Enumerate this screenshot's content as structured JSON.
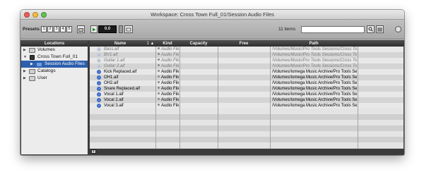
{
  "window": {
    "title": "Workspace: Cross Town Full_01/Session Audio Files"
  },
  "toolbar": {
    "presets_label": "Presets:",
    "presets": [
      "1",
      "2",
      "3",
      "4",
      "5"
    ],
    "zoom_value": "0.0",
    "item_count": "11 items",
    "search_placeholder": ""
  },
  "locations": {
    "header": "Locations",
    "items": [
      {
        "label": "Volumes",
        "icon": "folder-icon",
        "expanded": false
      },
      {
        "label": "Cross Town Full_01",
        "icon": "session-icon",
        "expanded": true
      },
      {
        "label": "Session Audio Files",
        "icon": "blue-folder-icon",
        "expanded": false,
        "selected": true
      },
      {
        "label": "Catalogs",
        "icon": "folder-icon",
        "expanded": false
      },
      {
        "label": "User",
        "icon": "folder-icon",
        "expanded": false
      }
    ]
  },
  "files": {
    "columns": {
      "name": "Name",
      "sort_indicator": "1 ▲",
      "kind": "Kind",
      "capacity": "Capacity",
      "free": "Free",
      "path": "Path"
    },
    "rows": [
      {
        "name": "Bass.aif",
        "kind": "Audio File",
        "path": "/Volumes/Music/Pro Tools Sessions/Cross Town/Cro",
        "offline": true
      },
      {
        "name": "BV1.aif",
        "kind": "Audio File",
        "path": "/Volumes/Music/Pro Tools Sessions/Cross Town/Cro",
        "offline": true
      },
      {
        "name": "Guitar 1.aif",
        "kind": "Audio File",
        "path": "/Volumes/Music/Pro Tools Sessions/Cross Town/Cro",
        "offline": true
      },
      {
        "name": "Guitar 2.aif",
        "kind": "Audio File",
        "path": "/Volumes/Music/Pro Tools Sessions/Cross Town/Cro",
        "offline": true
      },
      {
        "name": "Kick Replaced.aif",
        "kind": "Audio File",
        "path": "/Volumes/Iomega Music Archive/Pro Tools Se",
        "offline": false
      },
      {
        "name": "OH1.aif",
        "kind": "Audio File",
        "path": "/Volumes/Iomega Music Archive/Pro Tools Se",
        "offline": false
      },
      {
        "name": "OH2.aif",
        "kind": "Audio File",
        "path": "/Volumes/Iomega Music Archive/Pro Tools Se",
        "offline": false
      },
      {
        "name": "Snare Replaced.aif",
        "kind": "Audio File",
        "path": "/Volumes/Iomega Music Archive/Pro Tools Se",
        "offline": false
      },
      {
        "name": "Vocal 1.aif",
        "kind": "Audio File",
        "path": "/Volumes/Iomega Music Archive/Pro Tools Se",
        "offline": false
      },
      {
        "name": "Vocal 2.aif",
        "kind": "Audio File",
        "path": "/Volumes/Iomega Music Archive/Pro Tools Se",
        "offline": false
      },
      {
        "name": "Vocal 3.aif",
        "kind": "Audio File",
        "path": "/Volumes/Iomega Music Archive/Pro Tools Se",
        "offline": false
      }
    ]
  }
}
